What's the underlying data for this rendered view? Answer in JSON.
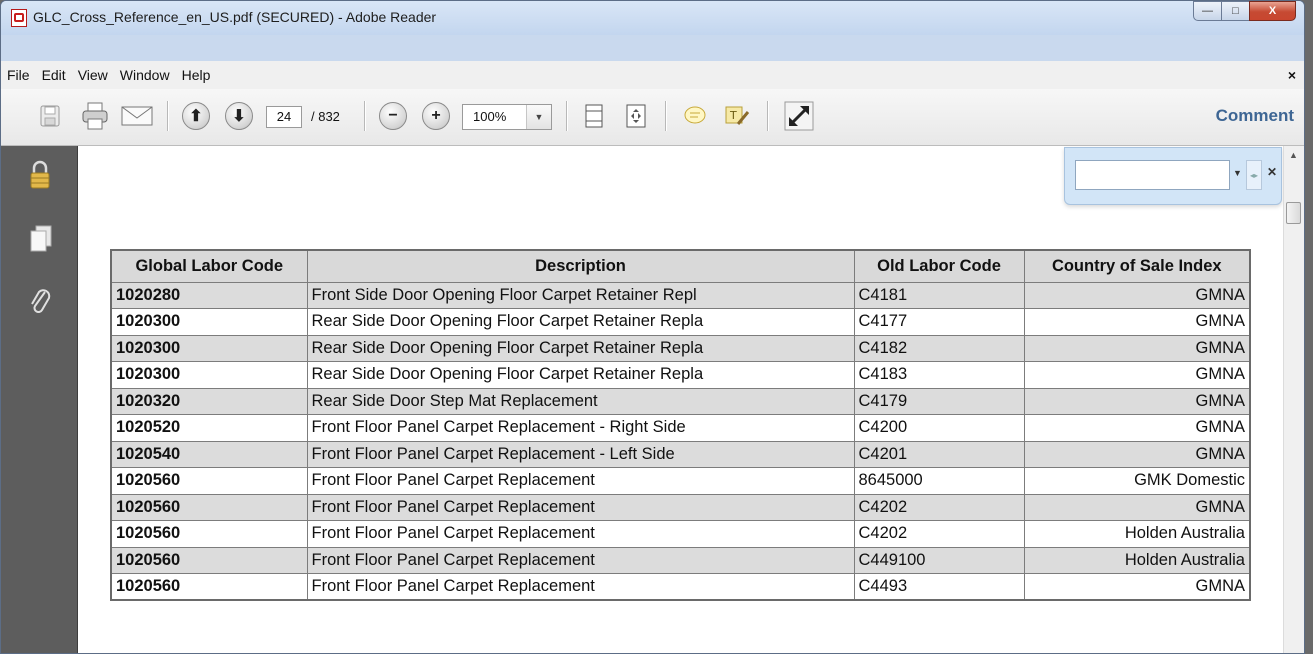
{
  "window": {
    "title": "GLC_Cross_Reference_en_US.pdf (SECURED) - Adobe Reader",
    "min_glyph": "—",
    "max_glyph": "□",
    "close_glyph": "X"
  },
  "menu": {
    "items": [
      "File",
      "Edit",
      "View",
      "Window",
      "Help"
    ],
    "close_glyph": "×"
  },
  "toolbar": {
    "page_current": "24",
    "page_total": "/ 832",
    "zoom": "100%",
    "comment_label": "Comment"
  },
  "find": {
    "placeholder": ""
  },
  "table": {
    "headers": [
      "Global Labor Code",
      "Description",
      "Old Labor Code",
      "Country of Sale Index"
    ],
    "rows": [
      [
        "1020280",
        "Front Side Door Opening Floor Carpet Retainer Repl",
        "C4181",
        "GMNA"
      ],
      [
        "1020300",
        "Rear Side Door Opening Floor Carpet Retainer Repla",
        "C4177",
        "GMNA"
      ],
      [
        "1020300",
        "Rear Side Door Opening Floor Carpet Retainer Repla",
        "C4182",
        "GMNA"
      ],
      [
        "1020300",
        "Rear Side Door Opening Floor Carpet Retainer Repla",
        "C4183",
        "GMNA"
      ],
      [
        "1020320",
        "Rear Side Door Step Mat Replacement",
        "C4179",
        "GMNA"
      ],
      [
        "1020520",
        "Front Floor Panel Carpet Replacement - Right Side",
        "C4200",
        "GMNA"
      ],
      [
        "1020540",
        "Front Floor Panel Carpet Replacement - Left Side",
        "C4201",
        "GMNA"
      ],
      [
        "1020560",
        "Front Floor Panel Carpet Replacement",
        "8645000",
        "GMK Domestic"
      ],
      [
        "1020560",
        "Front Floor Panel Carpet Replacement",
        "C4202",
        "GMNA"
      ],
      [
        "1020560",
        "Front Floor Panel Carpet Replacement",
        "C4202",
        "Holden Australia"
      ],
      [
        "1020560",
        "Front Floor Panel Carpet Replacement",
        "C449100",
        "Holden Australia"
      ],
      [
        "1020560",
        "Front Floor Panel Carpet Replacement",
        "C4493",
        "GMNA"
      ]
    ]
  }
}
